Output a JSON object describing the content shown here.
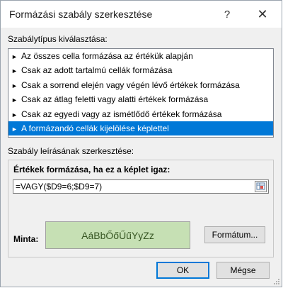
{
  "dialog": {
    "title": "Formázási szabály szerkesztése",
    "help_glyph": "?",
    "close_glyph": "✕"
  },
  "rule_type": {
    "label": "Szabálytípus kiválasztása:",
    "items": [
      {
        "label": "Az összes cella formázása az értékük alapján",
        "selected": false
      },
      {
        "label": "Csak az adott tartalmú cellák formázása",
        "selected": false
      },
      {
        "label": "Csak a sorrend elején vagy végén lévő értékek formázása",
        "selected": false
      },
      {
        "label": "Csak az átlag feletti vagy alatti értékek formázása",
        "selected": false
      },
      {
        "label": "Csak az egyedi vagy az ismétlődő értékek formázása",
        "selected": false
      },
      {
        "label": "A formázandó cellák kijelölése képlettel",
        "selected": true
      }
    ],
    "bullet": "►"
  },
  "rule_description": {
    "label": "Szabály leírásának szerkesztése:",
    "formula_label": "Értékek formázása, ha ez a képlet igaz:",
    "formula_value": "=VAGY($D9=6;$D9=7)",
    "sample_label": "Minta:",
    "sample_text": "AáBbŐőŰűYyZz",
    "sample_fill": "#c6e0b4",
    "format_button": "Formátum..."
  },
  "footer": {
    "ok": "OK",
    "cancel": "Mégse"
  },
  "colors": {
    "selection": "#0078d7",
    "accent_border": "#0078d7"
  }
}
